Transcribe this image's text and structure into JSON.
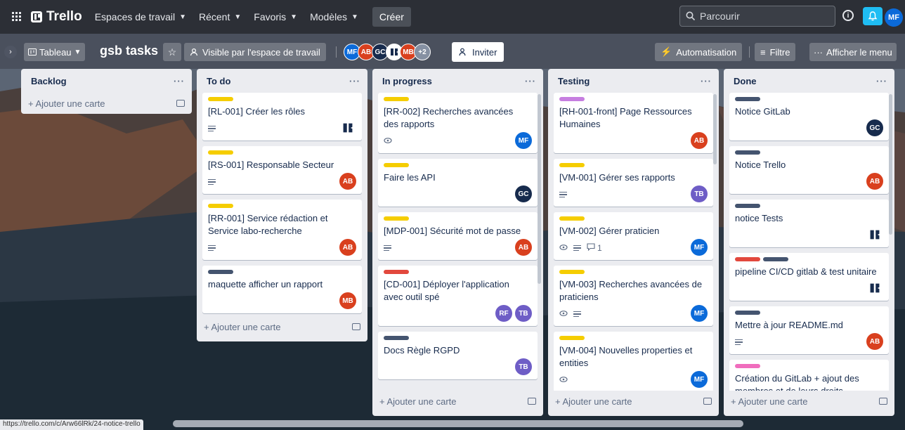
{
  "topnav": {
    "logo": "Trello",
    "items": [
      "Espaces de travail",
      "Récent",
      "Favoris",
      "Modèles"
    ],
    "create": "Créer",
    "search_placeholder": "Parcourir",
    "user_initials": "MF"
  },
  "board": {
    "view": "Tableau",
    "title": "gsb tasks",
    "visibility": "Visible par l'espace de travail",
    "members": [
      {
        "initials": "MF",
        "color": "#0b6ad9"
      },
      {
        "initials": "AB",
        "color": "#d9401e"
      },
      {
        "initials": "GC",
        "color": "#172b4d"
      },
      {
        "initials": "",
        "color": "#ffffff"
      },
      {
        "initials": "MB",
        "color": "#d9401e"
      }
    ],
    "extra_members": "+2",
    "invite": "Inviter",
    "automation": "Automatisation",
    "filter": "Filtre",
    "menu": "Afficher le menu"
  },
  "add_card_label": "+ Ajouter une carte",
  "lists": [
    {
      "title": "Backlog",
      "cards": []
    },
    {
      "title": "To do",
      "cards": [
        {
          "title": "[RL-001] Créer les rôles",
          "labels": [
            "#f5cd00"
          ],
          "badges": [
            "desc"
          ],
          "members": [
            {
              "initials": "",
              "color": "logo"
            }
          ]
        },
        {
          "title": "[RS-001] Responsable Secteur",
          "labels": [
            "#f5cd00"
          ],
          "badges": [
            "desc"
          ],
          "members": [
            {
              "initials": "AB",
              "color": "#d9401e"
            }
          ]
        },
        {
          "title": "[RR-001] Service rédaction et Service labo-recherche",
          "labels": [
            "#f5cd00"
          ],
          "badges": [
            "desc"
          ],
          "members": [
            {
              "initials": "AB",
              "color": "#d9401e"
            }
          ]
        },
        {
          "title": "maquette afficher un rapport",
          "labels": [
            "#44546f"
          ],
          "badges": [],
          "members": [
            {
              "initials": "MB",
              "color": "#d9401e"
            }
          ]
        }
      ]
    },
    {
      "title": "In progress",
      "cards": [
        {
          "title": "[RR-002] Recherches avancées des rapports",
          "labels": [
            "#f5cd00"
          ],
          "badges": [
            "watch"
          ],
          "members": [
            {
              "initials": "MF",
              "color": "#0b6ad9"
            }
          ]
        },
        {
          "title": "Faire les API",
          "labels": [
            "#f5cd00"
          ],
          "badges": [],
          "members": [
            {
              "initials": "GC",
              "color": "#172b4d"
            }
          ]
        },
        {
          "title": "[MDP-001] Sécurité mot de passe",
          "labels": [
            "#f5cd00"
          ],
          "badges": [
            "desc"
          ],
          "members": [
            {
              "initials": "AB",
              "color": "#d9401e"
            }
          ]
        },
        {
          "title": "[CD-001] Déployer l'application avec outil spé",
          "labels": [
            "#e2483d"
          ],
          "badges": [],
          "members": [
            {
              "initials": "RF",
              "color": "#6e5dc6"
            },
            {
              "initials": "TB",
              "color": "#6e5dc6"
            }
          ]
        },
        {
          "title": "Docs Règle RGPD",
          "labels": [
            "#44546f"
          ],
          "badges": [],
          "members": [
            {
              "initials": "TB",
              "color": "#6e5dc6"
            }
          ]
        }
      ]
    },
    {
      "title": "Testing",
      "cards": [
        {
          "title": "[RH-001-front] Page Ressources Humaines",
          "labels": [
            "#c67ee0"
          ],
          "badges": [],
          "members": [
            {
              "initials": "AB",
              "color": "#d9401e"
            }
          ]
        },
        {
          "title": "[VM-001] Gérer ses rapports",
          "labels": [
            "#f5cd00"
          ],
          "badges": [
            "desc"
          ],
          "members": [
            {
              "initials": "TB",
              "color": "#6e5dc6"
            }
          ]
        },
        {
          "title": "[VM-002] Gérer praticien",
          "labels": [
            "#f5cd00"
          ],
          "badges": [
            "watch",
            "desc",
            "comment"
          ],
          "comment_count": "1",
          "members": [
            {
              "initials": "MF",
              "color": "#0b6ad9"
            }
          ]
        },
        {
          "title": "[VM-003] Recherches avancées de praticiens",
          "labels": [
            "#f5cd00"
          ],
          "badges": [
            "watch",
            "desc"
          ],
          "members": [
            {
              "initials": "MF",
              "color": "#0b6ad9"
            }
          ]
        },
        {
          "title": "[VM-004] Nouvelles properties et entities",
          "labels": [
            "#f5cd00"
          ],
          "badges": [
            "watch"
          ],
          "members": [
            {
              "initials": "MF",
              "color": "#0b6ad9"
            }
          ]
        }
      ]
    },
    {
      "title": "Done",
      "cards": [
        {
          "title": "Notice GitLab",
          "labels": [
            "#44546f"
          ],
          "badges": [],
          "members": [
            {
              "initials": "GC",
              "color": "#172b4d"
            }
          ]
        },
        {
          "title": "Notice Trello",
          "labels": [
            "#44546f"
          ],
          "badges": [],
          "members": [
            {
              "initials": "AB",
              "color": "#d9401e"
            }
          ]
        },
        {
          "title": "notice Tests",
          "labels": [
            "#44546f"
          ],
          "badges": [],
          "members": [
            {
              "initials": "",
              "color": "logo"
            }
          ]
        },
        {
          "title": "pipeline CI/CD gitlab & test unitaire",
          "labels": [
            "#e2483d",
            "#44546f"
          ],
          "badges": [],
          "members": [
            {
              "initials": "",
              "color": "logo"
            }
          ]
        },
        {
          "title": "Mettre à jour README.md",
          "labels": [
            "#44546f"
          ],
          "badges": [
            "desc"
          ],
          "members": [
            {
              "initials": "AB",
              "color": "#d9401e"
            }
          ]
        },
        {
          "title": "Création du GitLab + ajout des membres et de leurs droits",
          "labels": [
            "#f06dbd"
          ],
          "badges": [],
          "members": []
        }
      ]
    }
  ],
  "status_url": "https://trello.com/c/Arw66lRk/24-notice-trello"
}
